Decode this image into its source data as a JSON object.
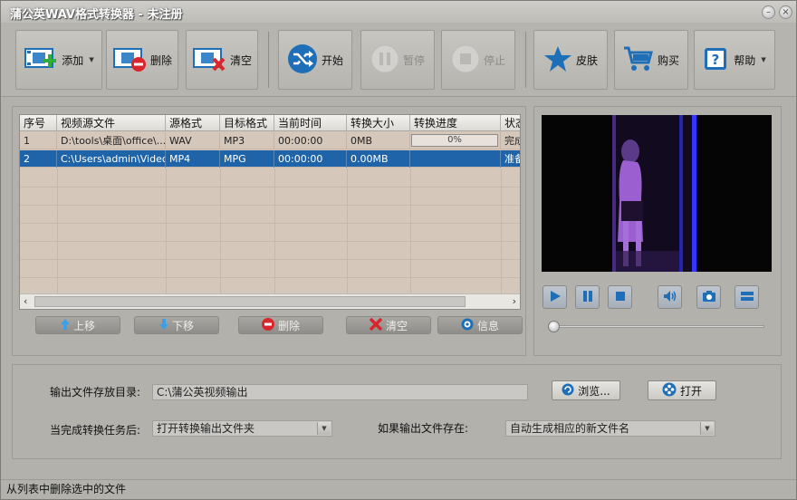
{
  "window": {
    "title": "蒲公英WAV格式转换器 - 未注册",
    "minimize": "–",
    "close": "×"
  },
  "toolbar": {
    "add": "添加",
    "delete": "删除",
    "clear": "清空",
    "start": "开始",
    "pause": "暂停",
    "stop": "停止",
    "skin": "皮肤",
    "buy": "购买",
    "help": "帮助"
  },
  "file_list": {
    "columns": [
      "序号",
      "视频源文件",
      "源格式",
      "目标格式",
      "当前时间",
      "转换大小",
      "转换进度",
      "状态"
    ],
    "rows": [
      {
        "index": "1",
        "source": "D:\\tools\\桌面\\office\\...",
        "src_format": "WAV",
        "dst_format": "MP3",
        "time": "00:00:00",
        "size": "0MB",
        "progress": "0%",
        "state": "完成"
      },
      {
        "index": "2",
        "source": "C:\\Users\\admin\\Video...",
        "src_format": "MP4",
        "dst_format": "MPG",
        "time": "00:00:00",
        "size": "0.00MB",
        "progress": "",
        "state": "准备"
      }
    ],
    "selected_row": 2
  },
  "list_buttons": {
    "up": "上移",
    "down": "下移",
    "delete": "删除",
    "clear": "清空",
    "info": "信息"
  },
  "player": {
    "progress": 0
  },
  "output": {
    "dir_label": "输出文件存放目录:",
    "dir_value": "C:\\蒲公英视频输出",
    "browse": "浏览...",
    "open": "打开",
    "after_label": "当完成转换任务后:",
    "after_value": "打开转换输出文件夹",
    "exists_label": "如果输出文件存在:",
    "exists_value": "自动生成相应的新文件名"
  },
  "status": {
    "text": "从列表中删除选中的文件"
  },
  "colors": {
    "selection": "#1f64a8",
    "grid_bg": "#d6c7bb",
    "accent_blue": "#1e6fb8",
    "danger_red": "#d8262c"
  }
}
